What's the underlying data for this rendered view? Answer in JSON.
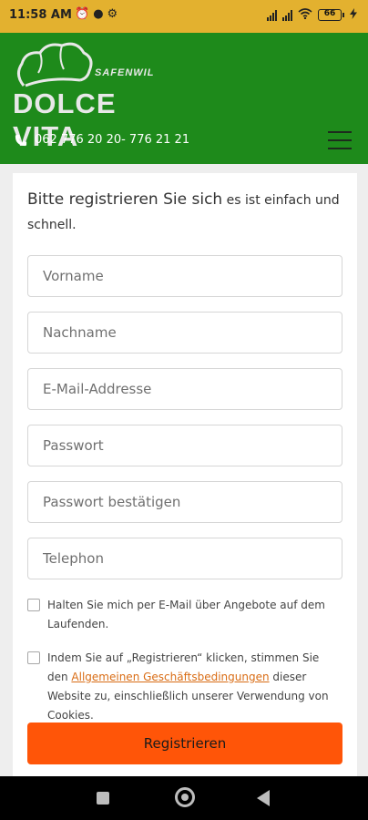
{
  "status_bar": {
    "time": "11:58 AM",
    "battery_level": "66",
    "icons": [
      "alarm-icon",
      "notification-icon",
      "settings-icon",
      "signal-icon",
      "signal-icon",
      "wifi-icon",
      "battery-icon",
      "charging-icon"
    ]
  },
  "header": {
    "logo": {
      "town": "SAFENWIL",
      "brand": "DOLCE VITA"
    },
    "phone": "062 776 20 20- 776 21 21",
    "menu_icon": "hamburger-menu-icon"
  },
  "form": {
    "heading_main": "Bitte registrieren Sie sich",
    "heading_sub": " es ist einfach und schnell.",
    "fields": {
      "first_name": {
        "placeholder": "Vorname",
        "value": ""
      },
      "last_name": {
        "placeholder": "Nachname",
        "value": ""
      },
      "email": {
        "placeholder": "E-Mail-Addresse",
        "value": ""
      },
      "password": {
        "placeholder": "Passwort",
        "value": ""
      },
      "password_confirm": {
        "placeholder": "Passwort bestätigen",
        "value": ""
      },
      "phone": {
        "placeholder": "Telephon",
        "value": ""
      }
    },
    "newsletter_label": "Halten Sie mich per E-Mail über Angebote auf dem Laufenden.",
    "terms_prefix": "Indem Sie auf „Registrieren“ klicken, stimmen Sie den ",
    "terms_link": "Allgemeinen Geschäftsbedingungen",
    "terms_suffix": " dieser Website zu, einschließlich unserer Verwendung von Cookies.",
    "submit_label": "Registrieren"
  },
  "colors": {
    "status_bar": "#e3b12f",
    "header": "#1e8a1b",
    "submit": "#ff5508",
    "link": "#d96c14"
  }
}
